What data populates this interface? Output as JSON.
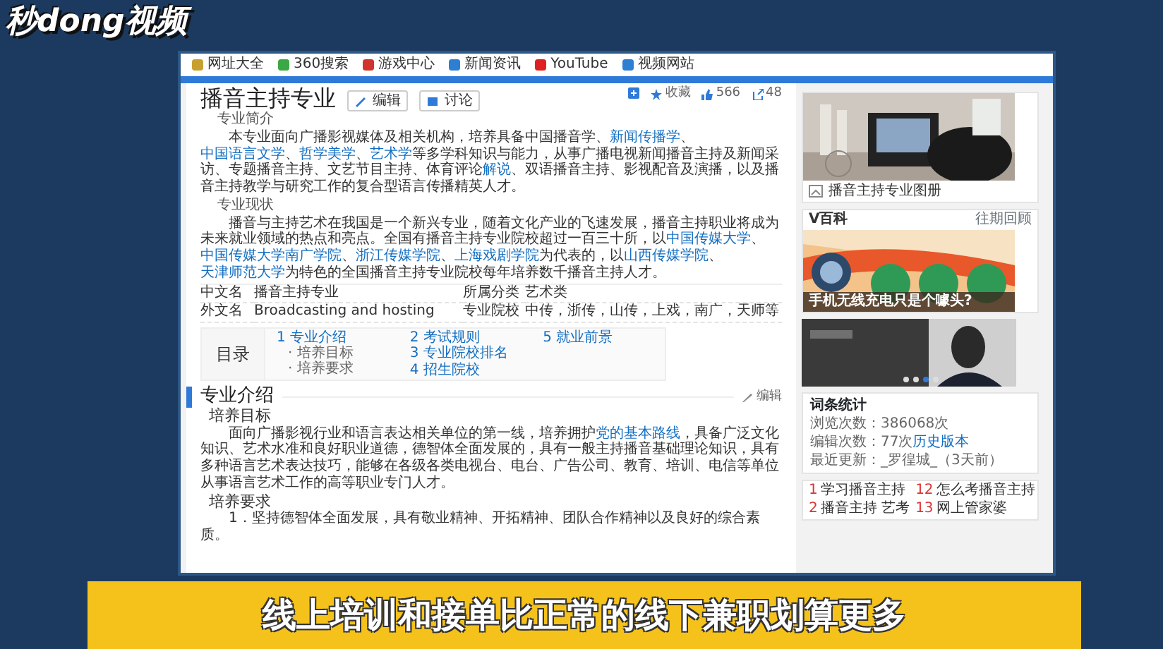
{
  "logo": {
    "text": "秒dong视频"
  },
  "bookmarks": [
    {
      "label": "网址大全",
      "color": "#c8a030"
    },
    {
      "label": "360搜索",
      "color": "#3aa845"
    },
    {
      "label": "游戏中心",
      "color": "#d0342c"
    },
    {
      "label": "新闻资讯",
      "color": "#2d7fd3"
    },
    {
      "label": "YouTube",
      "color": "#e02020"
    },
    {
      "label": "视频网站",
      "color": "#2d7fd3"
    }
  ],
  "actions": [
    {
      "kind": "add"
    },
    {
      "kind": "star",
      "label": "收藏"
    },
    {
      "kind": "like",
      "label": "566"
    },
    {
      "kind": "share",
      "label": "48"
    }
  ],
  "article": {
    "title": "播音主持专业",
    "buttons": [
      {
        "kind": "edit",
        "label": "编辑"
      },
      {
        "kind": "discuss",
        "label": "讨论"
      }
    ],
    "blocks": [
      {
        "kind": "label",
        "text": "专业简介"
      },
      {
        "kind": "para",
        "segments": [
          {
            "text": "本专业面向广播影视媒体及相关机构，培养具备中国播音学、",
            "kind": "text"
          },
          {
            "text": "新闻传播学",
            "kind": "link"
          },
          {
            "text": "、",
            "kind": "text"
          },
          {
            "text": "中国语言文学",
            "kind": "link"
          },
          {
            "text": "、",
            "kind": "text"
          },
          {
            "text": "哲学美学",
            "kind": "link"
          },
          {
            "text": "、",
            "kind": "text"
          },
          {
            "text": "艺术学",
            "kind": "link"
          },
          {
            "text": "等多学科知识与能力，从事广播电视新闻播音主持及新闻采访、专题播音主持、文艺节目主持、体育评论",
            "kind": "text"
          },
          {
            "text": "解说",
            "kind": "link"
          },
          {
            "text": "、双语播音主持、影视配音及演播，以及播音主持教学与研究工作的复合型语言传播精英人才。",
            "kind": "text"
          }
        ]
      },
      {
        "kind": "label",
        "text": "专业现状"
      },
      {
        "kind": "para",
        "segments": [
          {
            "text": "播音与主持艺术在我国是一个新兴专业，随着文化产业的飞速发展，播音主持职业将成为未来就业领域的热点和亮点。全国有播音主持专业院校超过一百三十所，以",
            "kind": "text"
          },
          {
            "text": "中国传媒大学",
            "kind": "link"
          },
          {
            "text": "、",
            "kind": "text"
          },
          {
            "text": "中国传媒大学南广学院",
            "kind": "link"
          },
          {
            "text": "、",
            "kind": "text"
          },
          {
            "text": "浙江传媒学院",
            "kind": "link"
          },
          {
            "text": "、",
            "kind": "text"
          },
          {
            "text": "上海戏剧学院",
            "kind": "link"
          },
          {
            "text": "为代表的，以",
            "kind": "text"
          },
          {
            "text": "山西传媒学院",
            "kind": "link"
          },
          {
            "text": "、",
            "kind": "text"
          },
          {
            "text": "天津师范大学",
            "kind": "link"
          },
          {
            "text": "为特色的全国播音主持专业院校每年培养数千播音主持人才。",
            "kind": "text"
          }
        ]
      }
    ],
    "info": [
      {
        "name": "中文名",
        "value": "播音主持专业",
        "name2": "所属分类",
        "value2": "艺术类"
      },
      {
        "name": "外文名",
        "value": "Broadcasting and hosting",
        "name2": "专业院校",
        "value2": "中传，浙传，山传，上戏，南广，天师等"
      }
    ],
    "toc": {
      "heading": "目录",
      "columns": [
        [
          {
            "num": "1",
            "label": "专业介绍",
            "children": [
              {
                "label": "· 培养目标"
              },
              {
                "label": "· 培养要求"
              }
            ]
          }
        ],
        [
          {
            "num": "2",
            "label": "考试规则"
          },
          {
            "num": "3",
            "label": "专业院校排名"
          },
          {
            "num": "4",
            "label": "招生院校"
          }
        ],
        [
          {
            "num": "5",
            "label": "就业前景"
          }
        ]
      ]
    },
    "section": {
      "title": "专业介绍",
      "edit": "编辑",
      "parts": [
        {
          "kind": "subhead",
          "text": "培养目标"
        },
        {
          "kind": "para",
          "segments": [
            {
              "text": "面向广播影视行业和语言表达相关单位的第一线，培养拥护",
              "kind": "text"
            },
            {
              "text": "党的基本路线",
              "kind": "link"
            },
            {
              "text": "，具备广泛文化知识、艺术水准和良好职业道德，德智体全面发展的，具有一般主持播音基础理论知识，具有多种语言艺术表达技巧，能够在各级各类电视台、电台、广告公司、教育、培训、电信等单位从事语言艺术工作的高等职业专门人才。",
              "kind": "text"
            }
          ]
        },
        {
          "kind": "subhead",
          "text": "培养要求"
        },
        {
          "kind": "para",
          "segments": [
            {
              "text": "1．坚持德智体全面发展，具有敬业精神、开拓精神、团队合作精神以及良好的综合素质。",
              "kind": "text"
            }
          ]
        }
      ]
    }
  },
  "sidebar": {
    "album": {
      "caption": "播音主持专业图册"
    },
    "vbaike": {
      "title": "V百科",
      "more": "往期回顾",
      "caption": "手机无线充电只是个噱头?"
    },
    "carousel": {
      "dots": [
        {
          "selected": false
        },
        {
          "selected": false
        },
        {
          "selected": true
        },
        {
          "selected": false
        }
      ]
    },
    "stats": {
      "title": "词条统计",
      "lines": [
        {
          "text": "浏览次数：386068次"
        },
        {
          "text": "编辑次数：77次",
          "link": "历史版本"
        },
        {
          "text": "最近更新：_罗徨城_（3天前）"
        }
      ]
    },
    "related": [
      {
        "num": "1",
        "label": "学习播音主持"
      },
      {
        "num": "12",
        "label": "怎么考播音主持"
      },
      {
        "num": "2",
        "label": "播音主持 艺考"
      },
      {
        "num": "13",
        "label": "网上管家婆"
      }
    ]
  },
  "subtitle": "线上培训和接单比正常的线下兼职划算更多"
}
